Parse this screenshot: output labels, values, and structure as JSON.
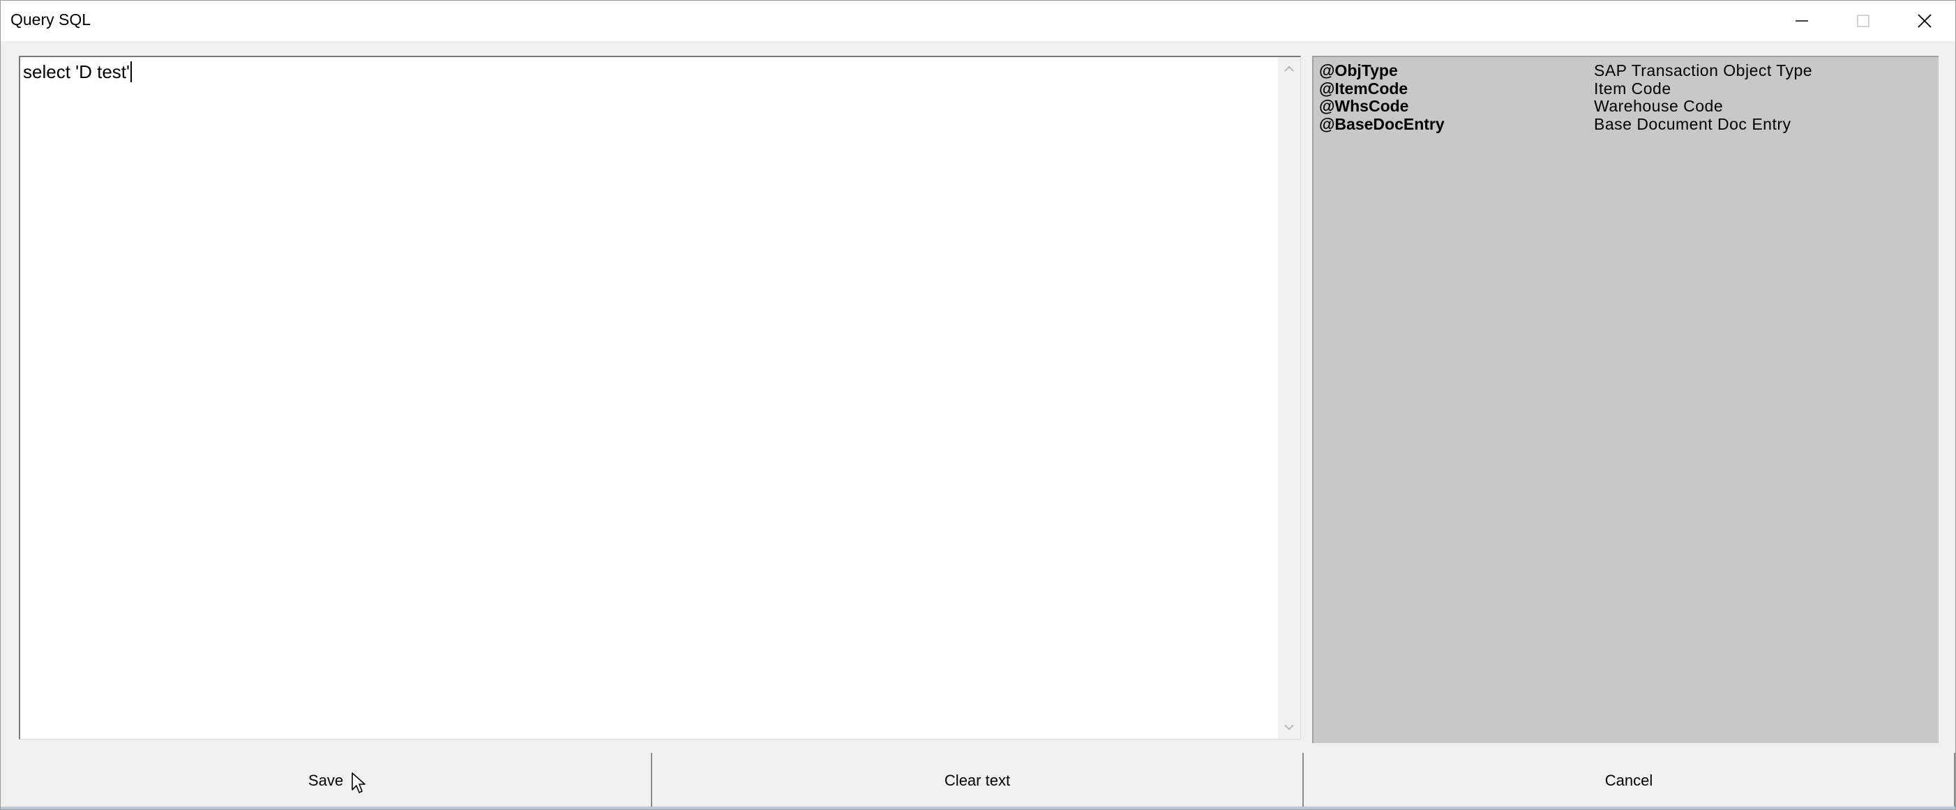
{
  "window": {
    "title": "Query SQL"
  },
  "titlebar_buttons": {
    "minimize_icon": "minimize-icon",
    "maximize_icon": "maximize-icon",
    "close_icon": "close-icon"
  },
  "editor": {
    "value": "select 'D test'"
  },
  "variables": [
    {
      "name": "@ObjType",
      "description": "SAP Transaction Object Type"
    },
    {
      "name": "@ItemCode",
      "description": "Item Code"
    },
    {
      "name": "@WhsCode",
      "description": "Warehouse Code"
    },
    {
      "name": "@BaseDocEntry",
      "description": "Base Document Doc Entry"
    }
  ],
  "buttons": {
    "save_label": "Save",
    "clear_label": "Clear text",
    "cancel_label": "Cancel"
  },
  "colors": {
    "panel_bg": "#c8c8c8",
    "window_bg": "#f0f0f0"
  }
}
